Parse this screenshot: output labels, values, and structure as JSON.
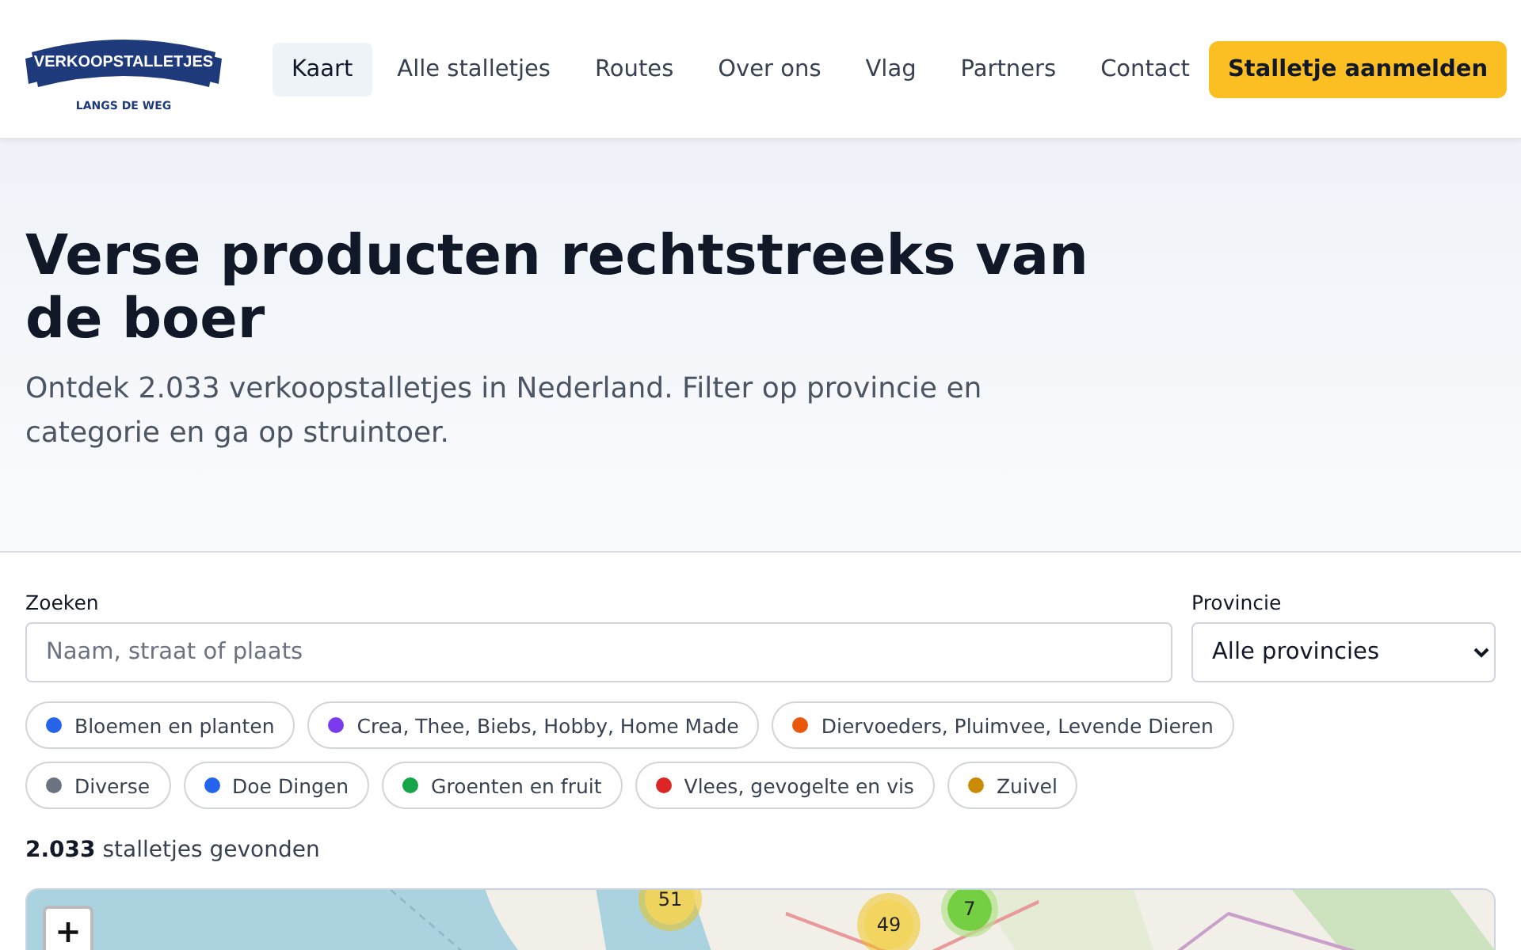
{
  "logo": {
    "title": "VERKOOPSTALLETJES",
    "subtitle": "LANGS DE WEG"
  },
  "nav": [
    {
      "label": "Kaart",
      "selected": true
    },
    {
      "label": "Alle stalletjes",
      "selected": false
    },
    {
      "label": "Routes",
      "selected": false
    },
    {
      "label": "Over ons",
      "selected": false
    },
    {
      "label": "Vlag",
      "selected": false
    },
    {
      "label": "Partners",
      "selected": false
    },
    {
      "label": "Contact",
      "selected": false
    }
  ],
  "cta": "Stalletje aanmelden",
  "hero": {
    "title": "Verse producten rechtstreeks van de boer",
    "text": "Ontdek 2.033 verkoopstalletjes in Nederland. Filter op provincie en categorie en ga op struintoer."
  },
  "search": {
    "label": "Zoeken",
    "placeholder": "Naam, straat of plaats"
  },
  "province": {
    "label": "Provincie",
    "value": "Alle provincies"
  },
  "categories": [
    {
      "label": "Bloemen en planten",
      "color": "#2563eb"
    },
    {
      "label": "Crea, Thee, Biebs, Hobby, Home Made",
      "color": "#7c3aed"
    },
    {
      "label": "Diervoeders, Pluimvee, Levende Dieren",
      "color": "#ea580c"
    },
    {
      "label": "Diverse",
      "color": "#6b7280"
    },
    {
      "label": "Doe Dingen",
      "color": "#2563eb"
    },
    {
      "label": "Groenten en fruit",
      "color": "#16a34a"
    },
    {
      "label": "Vlees, gevogelte en vis",
      "color": "#dc2626"
    },
    {
      "label": "Zuivel",
      "color": "#ca8a04"
    }
  ],
  "result": "**2.033** stalletjes gevonden",
  "map": {
    "zoom_in": "+",
    "clusters": [
      {
        "label": "51",
        "kind": "yellow"
      },
      {
        "label": "49",
        "kind": "yellow"
      },
      {
        "label": "7",
        "kind": "green"
      }
    ]
  }
}
